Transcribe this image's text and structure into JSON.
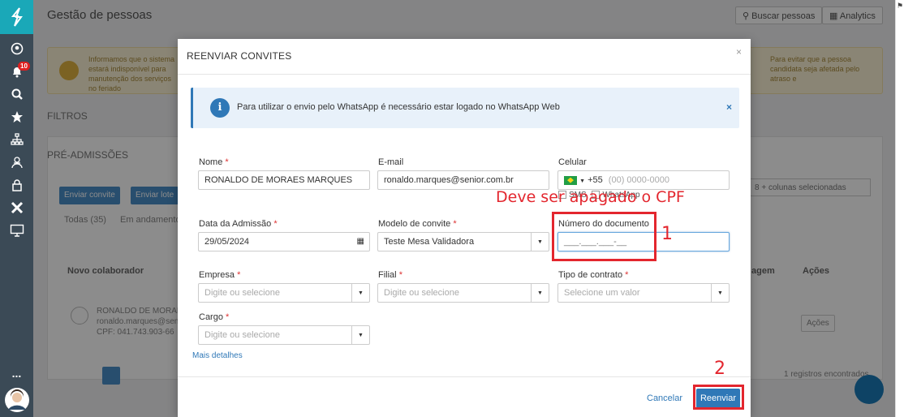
{
  "sidebar": {
    "badge_count": "10",
    "icons": [
      "user-circle-icon",
      "bell-icon",
      "search-icon",
      "star-icon",
      "org-chart-icon",
      "users-icon",
      "lock-icon",
      "x-brand-icon",
      "monitor-icon"
    ],
    "more": "..."
  },
  "background": {
    "title": "Gestão de pessoas",
    "search_button": "Buscar pessoas",
    "analytics_button": "Analytics",
    "warning_text_left": "Informamos que o sistema estará indisponível para manutenção dos serviços no feriado",
    "warning_text_right": "Para evitar que a pessoa candidata seja afetada pelo atraso e",
    "filters": "FILTROS",
    "section": "PRÉ-ADMISSÕES",
    "buttons": [
      "Enviar convite",
      "Enviar lote"
    ],
    "column_select": "8 + colunas selecionadas",
    "tabs": [
      "Todas (35)",
      "Em andamento"
    ],
    "header_new": "Novo colaborador",
    "header_stage": "agem",
    "header_actions": "Ações",
    "row_name": "RONALDO DE MORAES",
    "row_email": "ronaldo.marques@senior",
    "row_cpf": "CPF: 041.743.903-66",
    "row_actions": "Ações",
    "records": "1 registros encontrados"
  },
  "modal": {
    "title": "REENVIAR CONVITES",
    "close": "×",
    "info_text": "Para utilizar o envio pelo WhatsApp é necessário estar logado no WhatsApp Web",
    "info_close": "×",
    "fields": {
      "nome_label": "Nome",
      "nome_value": "RONALDO DE MORAES MARQUES",
      "email_label": "E-mail",
      "email_value": "ronaldo.marques@senior.com.br",
      "celular_label": "Celular",
      "ddi": "+55",
      "celular_placeholder": "(00) 0000-0000",
      "sms_label": "SMS",
      "whatsapp_label": "WhatsApp",
      "admissao_label": "Data da Admissão",
      "admissao_value": "29/05/2024",
      "modelo_label": "Modelo de convite",
      "modelo_value": "Teste Mesa Validadora",
      "documento_label": "Número do documento",
      "documento_value": "___.___.___-__",
      "empresa_label": "Empresa",
      "empresa_placeholder": "Digite ou selecione",
      "filial_label": "Filial",
      "filial_placeholder": "Digite ou selecione",
      "contrato_label": "Tipo de contrato",
      "contrato_placeholder": "Selecione um valor",
      "cargo_label": "Cargo",
      "cargo_placeholder": "Digite ou selecione",
      "required_mark": "*"
    },
    "more_details": "Mais detalhes",
    "cancel": "Cancelar",
    "resend": "Reenviar"
  },
  "annotations": {
    "note": "Deve ser apagado o CPF",
    "step1": "1",
    "step2": "2",
    "color": "#e3262e"
  }
}
